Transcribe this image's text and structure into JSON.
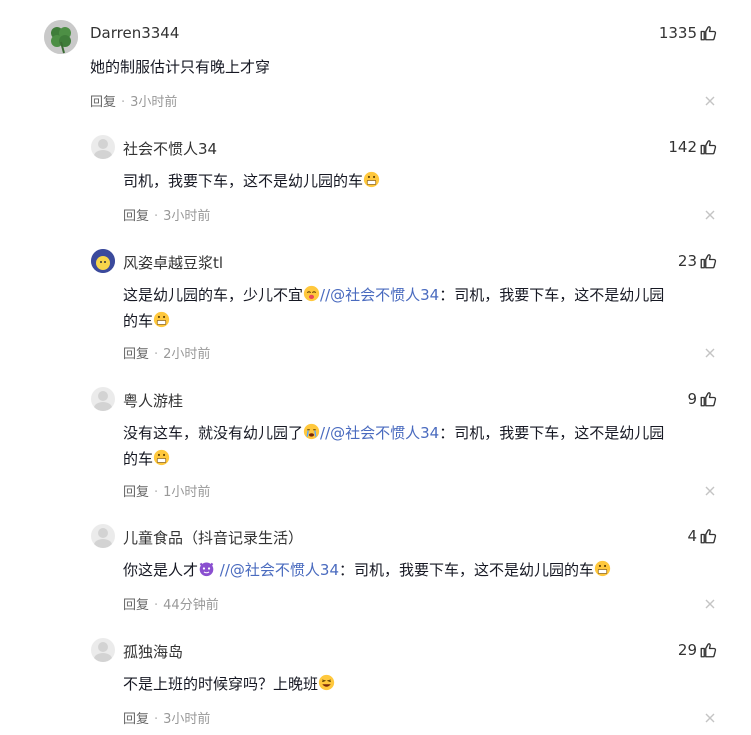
{
  "comments": [
    {
      "user": "Darren3344",
      "likes": "1335",
      "text": "她的制服估计只有晚上才穿",
      "reply": "回复",
      "time": "3小时前"
    },
    {
      "user": "社会不惯人34",
      "likes": "142",
      "text": "司机，我要下车，这不是幼儿园的车",
      "reply": "回复",
      "time": "3小时前"
    },
    {
      "user": "风姿卓越豆浆tl",
      "likes": "23",
      "text": "这是幼儿园的车，少儿不宜",
      "mention": "//@社会不惯人34",
      "rest": "：司机，我要下车，这不是幼儿园",
      "line2": "的车",
      "reply": "回复",
      "time": "2小时前"
    },
    {
      "user": "粤人游桂",
      "likes": "9",
      "text": "没有这车，就没有幼儿园了",
      "mention": "//@社会不惯人34",
      "rest": "：司机，我要下车，这不是幼儿园",
      "line2": "的车",
      "reply": "回复",
      "time": "1小时前"
    },
    {
      "user": "儿童食品（抖音记录生活）",
      "likes": "4",
      "text": "你这是人才",
      "mention": "//@社会不惯人34",
      "rest": "：司机，我要下车，这不是幼儿园的车",
      "reply": "回复",
      "time": "44分钟前"
    },
    {
      "user": "孤独海岛",
      "likes": "29",
      "text": "不是上班的时候穿吗？上晚班",
      "reply": "回复",
      "time": "3小时前"
    }
  ]
}
